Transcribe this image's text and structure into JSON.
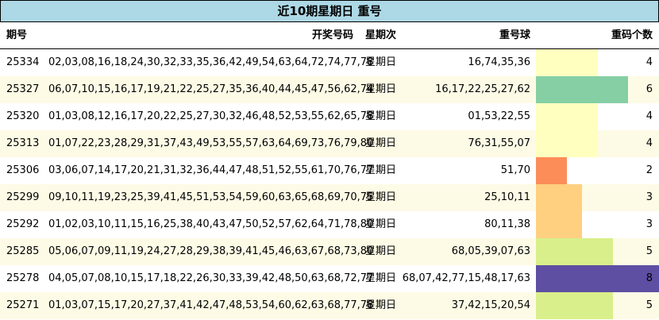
{
  "title": "近10期星期日 重号",
  "columns": {
    "issue": "期号",
    "numbers": "开奖号码",
    "weekday": "星期次",
    "repeat": "重号球",
    "count": "重码个数"
  },
  "colors": {
    "title_bg": "#add8e6",
    "row_alt_bg": "#fdfbe6",
    "count_2": "#fc8d59",
    "count_3": "#fed080",
    "count_4": "#ffffbf",
    "count_5": "#d9ef8b",
    "count_6": "#86cfa5",
    "count_8": "#5e4fa2"
  },
  "chart_data": {
    "type": "table",
    "max_count": 8,
    "rows": [
      {
        "issue": "25334",
        "numbers": "02,03,08,16,18,24,30,32,33,35,36,42,49,54,63,64,72,74,77,78",
        "weekday": "星期日",
        "repeat": "16,74,35,36",
        "count": 4,
        "color": "#ffffbf"
      },
      {
        "issue": "25327",
        "numbers": "06,07,10,15,16,17,19,21,22,25,27,35,36,40,44,45,47,56,62,74",
        "weekday": "星期日",
        "repeat": "16,17,22,25,27,62",
        "count": 6,
        "color": "#86cfa5"
      },
      {
        "issue": "25320",
        "numbers": "01,03,08,12,16,17,20,22,25,27,30,32,46,48,52,53,55,62,65,78",
        "weekday": "星期日",
        "repeat": "01,53,22,55",
        "count": 4,
        "color": "#ffffbf"
      },
      {
        "issue": "25313",
        "numbers": "01,07,22,23,28,29,31,37,43,49,53,55,57,63,64,69,73,76,79,80",
        "weekday": "星期日",
        "repeat": "76,31,55,07",
        "count": 4,
        "color": "#ffffbf"
      },
      {
        "issue": "25306",
        "numbers": "03,06,07,14,17,20,21,31,32,36,44,47,48,51,52,55,61,70,76,77",
        "weekday": "星期日",
        "repeat": "51,70",
        "count": 2,
        "color": "#fc8d59"
      },
      {
        "issue": "25299",
        "numbers": "09,10,11,19,23,25,39,41,45,51,53,54,59,60,63,65,68,69,70,75",
        "weekday": "星期日",
        "repeat": "25,10,11",
        "count": 3,
        "color": "#fed080"
      },
      {
        "issue": "25292",
        "numbers": "01,02,03,10,11,15,16,25,38,40,43,47,50,52,57,62,64,71,78,80",
        "weekday": "星期日",
        "repeat": "80,11,38",
        "count": 3,
        "color": "#fed080"
      },
      {
        "issue": "25285",
        "numbers": "05,06,07,09,11,19,24,27,28,29,38,39,41,45,46,63,67,68,73,80",
        "weekday": "星期日",
        "repeat": "68,05,39,07,63",
        "count": 5,
        "color": "#d9ef8b"
      },
      {
        "issue": "25278",
        "numbers": "04,05,07,08,10,15,17,18,22,26,30,33,39,42,48,50,63,68,72,77",
        "weekday": "星期日",
        "repeat": "68,07,42,77,15,48,17,63",
        "count": 8,
        "color": "#5e4fa2"
      },
      {
        "issue": "25271",
        "numbers": "01,03,07,15,17,20,27,37,41,42,47,48,53,54,60,62,63,68,77,78",
        "weekday": "星期日",
        "repeat": "37,42,15,20,54",
        "count": 5,
        "color": "#d9ef8b"
      }
    ]
  }
}
